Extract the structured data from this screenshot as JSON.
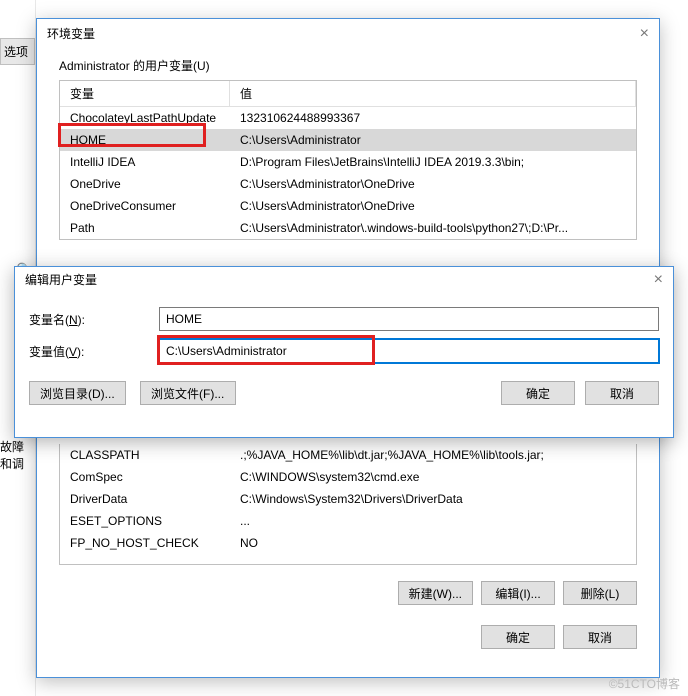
{
  "bg": {
    "tab_option": "选项",
    "filter_glyph": "🔍",
    "fault_label": "故障和调"
  },
  "env_dialog": {
    "title": "环境变量",
    "user_group_label": "Administrator 的用户变量(U)",
    "columns": {
      "variable": "变量",
      "value": "值"
    },
    "user_vars": [
      {
        "name": "ChocolateyLastPathUpdate",
        "value": "132310624488993367"
      },
      {
        "name": "HOME",
        "value": "C:\\Users\\Administrator"
      },
      {
        "name": "IntelliJ IDEA",
        "value": "D:\\Program Files\\JetBrains\\IntelliJ IDEA 2019.3.3\\bin;"
      },
      {
        "name": "OneDrive",
        "value": "C:\\Users\\Administrator\\OneDrive"
      },
      {
        "name": "OneDriveConsumer",
        "value": "C:\\Users\\Administrator\\OneDrive"
      },
      {
        "name": "Path",
        "value": "C:\\Users\\Administrator\\.windows-build-tools\\python27\\;D:\\Pr..."
      }
    ],
    "system_vars": [
      {
        "name": "CLASSPATH",
        "value": ".;%JAVA_HOME%\\lib\\dt.jar;%JAVA_HOME%\\lib\\tools.jar;"
      },
      {
        "name": "ComSpec",
        "value": "C:\\WINDOWS\\system32\\cmd.exe"
      },
      {
        "name": "DriverData",
        "value": "C:\\Windows\\System32\\Drivers\\DriverData"
      },
      {
        "name": "ESET_OPTIONS",
        "value": "                                                            ..."
      },
      {
        "name": "FP_NO_HOST_CHECK",
        "value": "NO"
      }
    ],
    "buttons": {
      "new": "新建(W)...",
      "edit": "编辑(I)...",
      "delete": "删除(L)",
      "ok": "确定",
      "cancel": "取消"
    }
  },
  "edit_dialog": {
    "title": "编辑用户变量",
    "name_label": "变量名(N):",
    "value_label": "变量值(V):",
    "name_value": "HOME",
    "value_value": "C:\\Users\\Administrator",
    "buttons": {
      "browse_dir": "浏览目录(D)...",
      "browse_file": "浏览文件(F)...",
      "ok": "确定",
      "cancel": "取消"
    }
  },
  "watermark": "©51CTO博客"
}
